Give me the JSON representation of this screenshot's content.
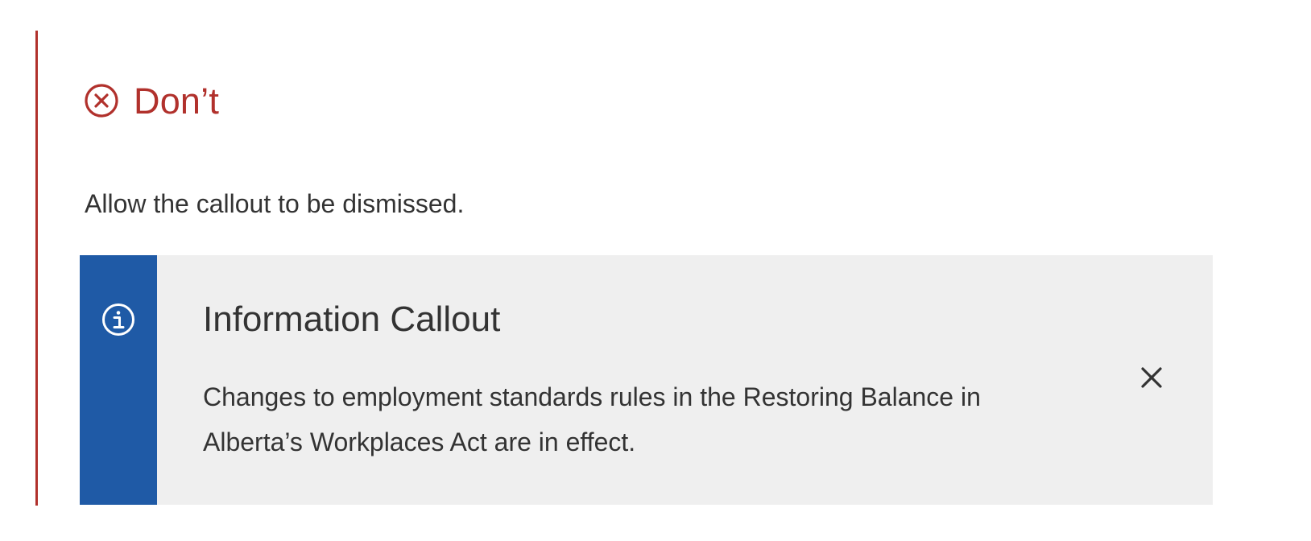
{
  "guideline": {
    "type_label": "Don’t",
    "type_icon": "close-circle-icon",
    "description": "Allow the callout to be dismissed."
  },
  "callout": {
    "icon": "information-icon",
    "title": "Information Callout",
    "message": "Changes to employment standards rules in the Restoring Balance in Alberta’s Workplaces Act are in effect.",
    "dismiss_icon": "close-icon"
  },
  "colors": {
    "dont_red": "#b1312c",
    "info_blue": "#1f5aa6",
    "callout_background": "#efefef",
    "text": "#333333"
  }
}
